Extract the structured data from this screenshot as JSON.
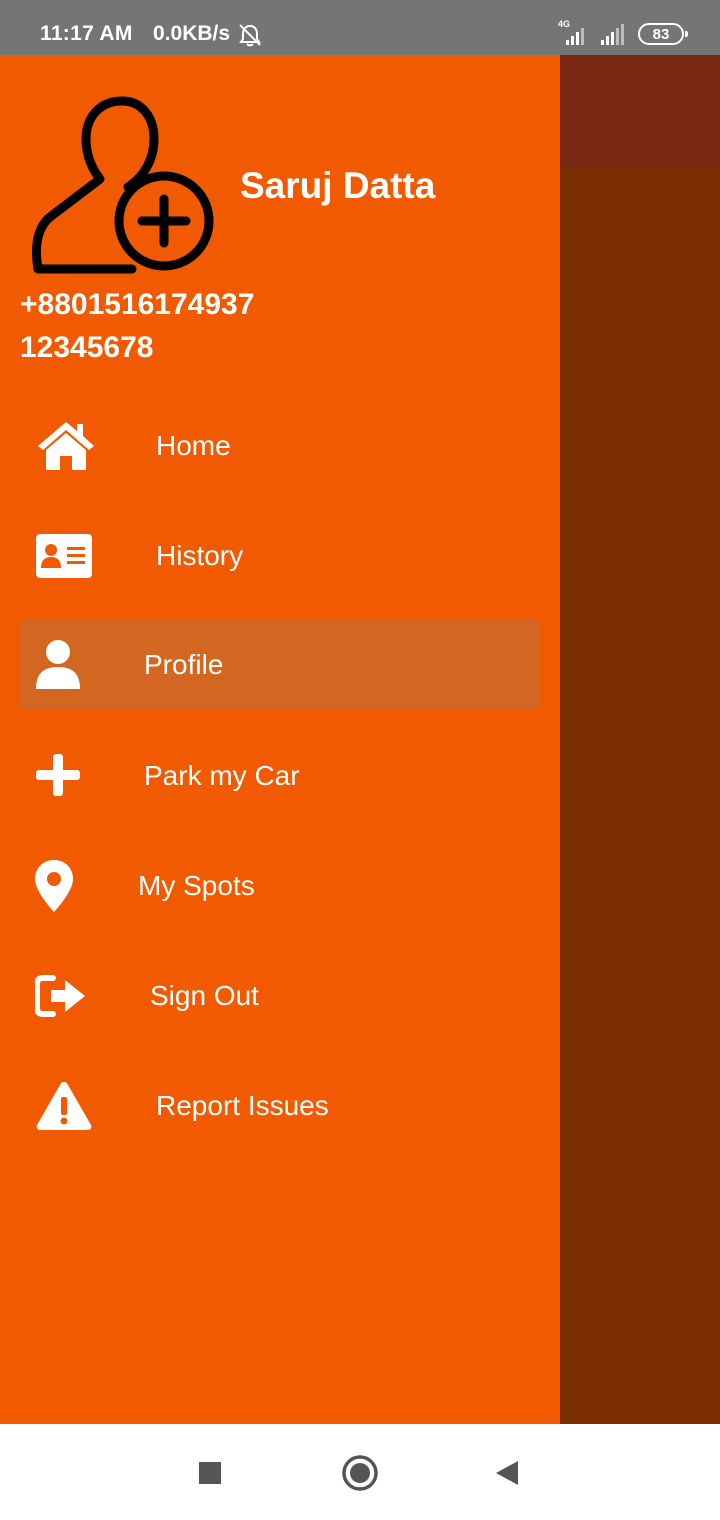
{
  "status_bar": {
    "time": "11:17 AM",
    "speed": "0.0KB/s",
    "network_tag": "4G",
    "battery": "83"
  },
  "drawer": {
    "user_name": "Saruj Datta",
    "phone": "+8801516174937",
    "user_id": "12345678",
    "items": [
      {
        "label": "Home",
        "icon": "home-icon"
      },
      {
        "label": "History",
        "icon": "id-card-icon"
      },
      {
        "label": "Profile",
        "icon": "user-icon",
        "selected": true
      },
      {
        "label": "Park my Car",
        "icon": "plus-icon"
      },
      {
        "label": "My Spots",
        "icon": "map-pin-icon"
      },
      {
        "label": "Sign Out",
        "icon": "sign-out-icon"
      },
      {
        "label": "Report Issues",
        "icon": "warning-icon"
      }
    ]
  },
  "colors": {
    "drawer_bg": "#f15a00",
    "selected_bg": "#d36722",
    "scrim": "#7a2d00",
    "status_bar": "#757575"
  },
  "nav_bar": {
    "buttons": [
      "recents-square-icon",
      "home-circle-icon",
      "back-triangle-icon"
    ]
  }
}
